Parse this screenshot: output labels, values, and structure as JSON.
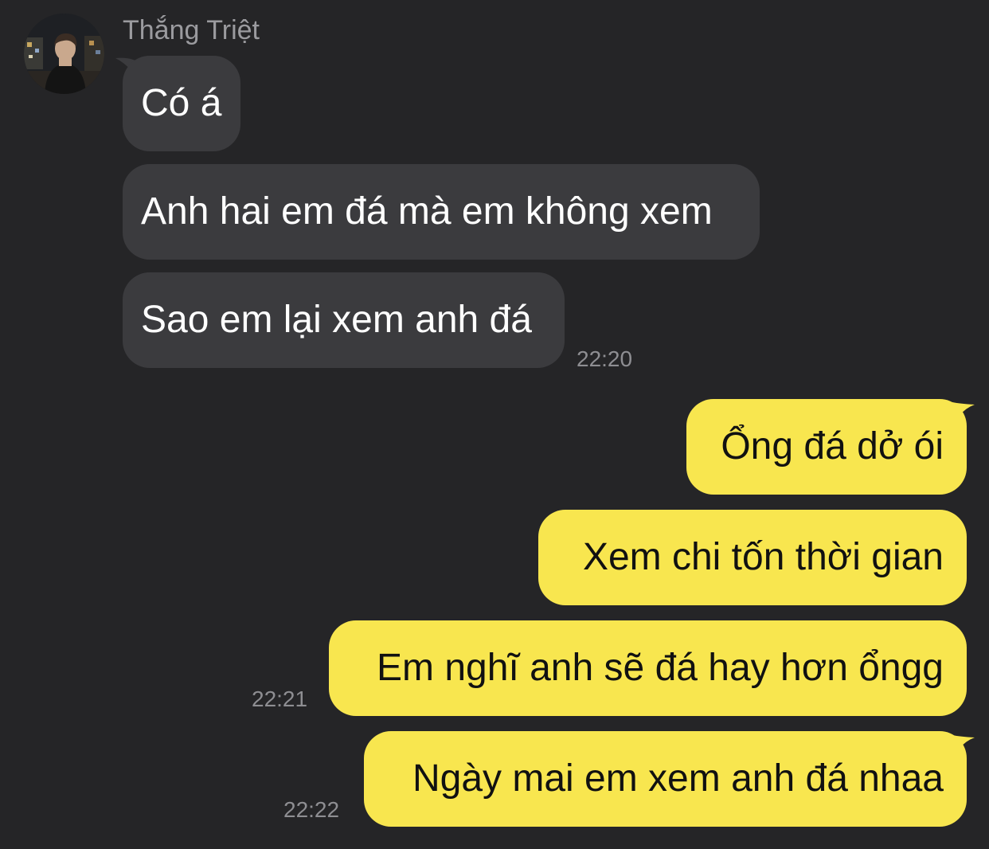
{
  "conversation": {
    "contact_name": "Thắng Triệt",
    "avatar_icon": "contact-avatar-photo",
    "incoming_color": "#3b3b3e",
    "outgoing_color": "#f8e64f",
    "background_color": "#252527"
  },
  "incoming": [
    {
      "text": "Có á"
    },
    {
      "text": "Anh hai em đá mà em không xem"
    },
    {
      "text": "Sao em lại xem anh đá"
    }
  ],
  "incoming_time": "22:20",
  "outgoing": [
    {
      "text": "Ổng đá dở ói"
    },
    {
      "text": "Xem chi tốn thời gian"
    },
    {
      "text": "Em nghĩ anh sẽ đá hay hơn ổngg"
    },
    {
      "text": "Ngày mai em xem anh đá nhaa"
    }
  ],
  "outgoing_times": [
    "22:21",
    "22:22"
  ]
}
